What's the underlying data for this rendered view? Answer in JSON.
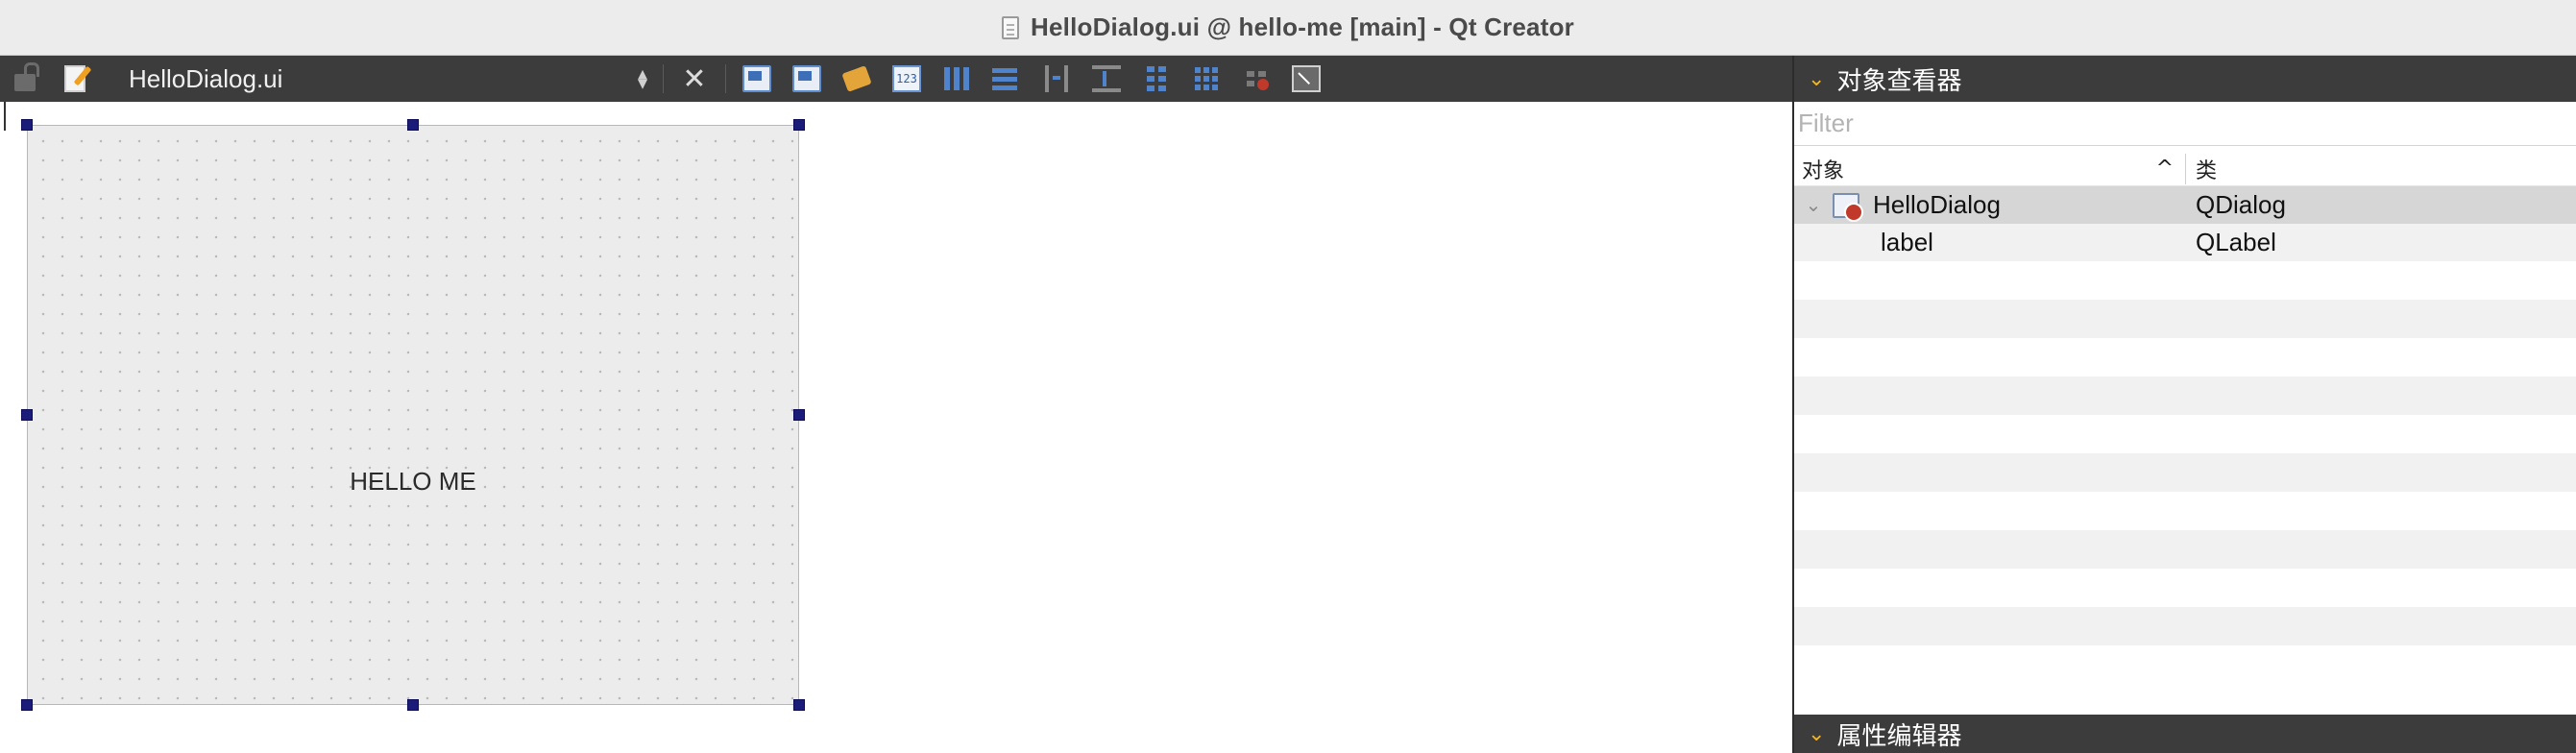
{
  "window": {
    "title": "HelloDialog.ui @ hello-me [main] - Qt Creator"
  },
  "toolbar": {
    "file_name": "HelloDialog.ui"
  },
  "form": {
    "label_text": "HELLO ME"
  },
  "object_inspector": {
    "title": "对象查看器",
    "filter_placeholder": "Filter",
    "col_object": "对象",
    "col_class": "类",
    "sort_indicator": "^",
    "rows": [
      {
        "object": "HelloDialog",
        "class": "QDialog"
      },
      {
        "object": "label",
        "class": "QLabel"
      }
    ]
  },
  "property_editor": {
    "title": "属性编辑器"
  }
}
